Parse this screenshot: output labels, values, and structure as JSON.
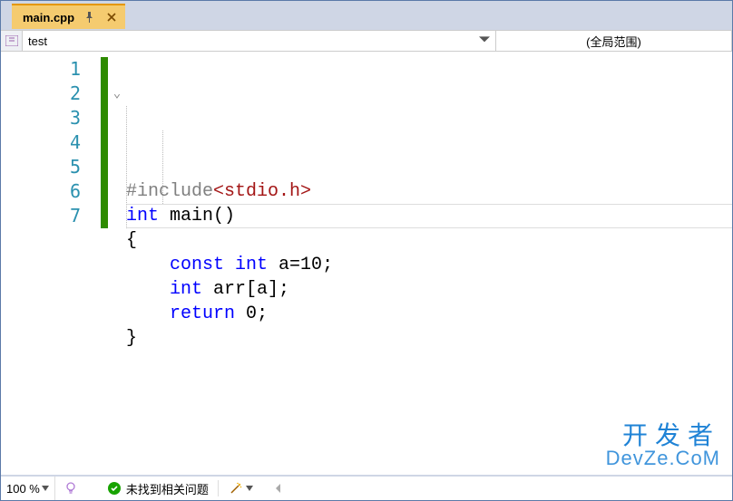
{
  "tab": {
    "title": "main.cpp",
    "pin_icon": "pin",
    "close_icon": "close"
  },
  "nav": {
    "left_value": "test",
    "right_value": "(全局范围)"
  },
  "editor": {
    "line_numbers": [
      "1",
      "2",
      "3",
      "4",
      "5",
      "6",
      "7"
    ],
    "code_lines": [
      {
        "tokens": [
          [
            "c-pp",
            "#include"
          ],
          [
            "c-angle",
            "<stdio.h>"
          ]
        ]
      },
      {
        "tokens": [
          [
            "c-kw",
            "int"
          ],
          [
            "",
            " "
          ],
          [
            "c-ident",
            "main"
          ],
          [
            "",
            "()"
          ]
        ]
      },
      {
        "tokens": [
          [
            "",
            "{"
          ]
        ]
      },
      {
        "tokens": [
          [
            "c-kw",
            "    const int"
          ],
          [
            "",
            " a="
          ],
          [
            "c-num",
            "10"
          ],
          [
            "",
            ";"
          ]
        ]
      },
      {
        "tokens": [
          [
            "c-kw",
            "    int"
          ],
          [
            "",
            " arr[a];"
          ]
        ]
      },
      {
        "tokens": [
          [
            "c-kw",
            "    return"
          ],
          [
            "",
            " "
          ],
          [
            "c-num",
            "0"
          ],
          [
            "",
            ";"
          ]
        ]
      },
      {
        "tokens": [
          [
            "",
            "}"
          ]
        ]
      }
    ]
  },
  "status": {
    "zoom": "100 %",
    "issues_text": "未找到相关问题"
  },
  "watermark": {
    "line1": "开发者",
    "line2": "DevZe.CoM"
  }
}
